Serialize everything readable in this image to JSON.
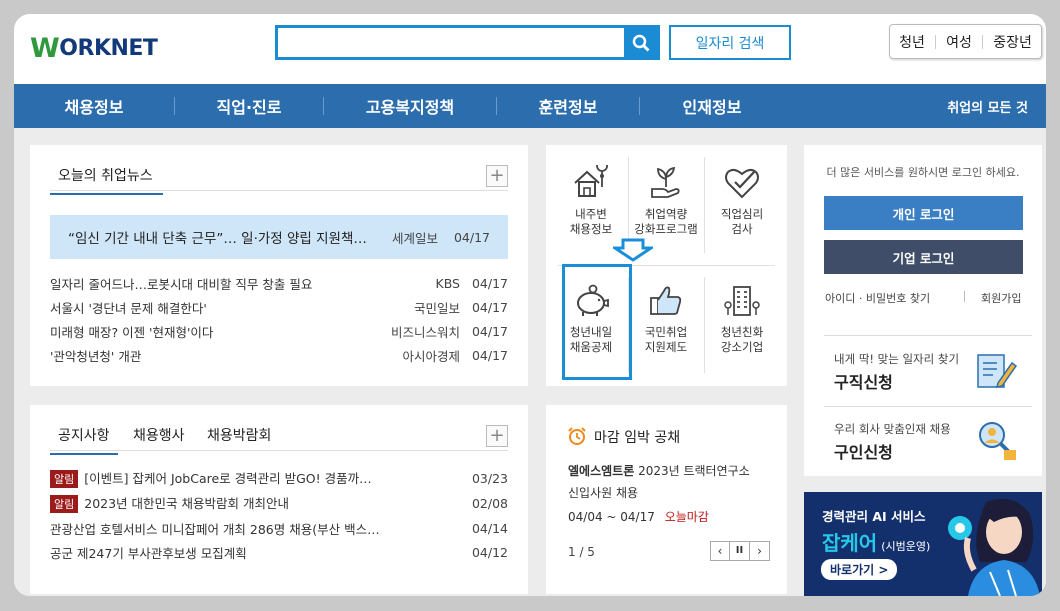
{
  "header": {
    "logo_w": "W",
    "logo_rest": "ORKNET",
    "search_placeholder": "",
    "job_search_label": "일자리 검색",
    "user_types": [
      "청년",
      "여성",
      "중장년"
    ]
  },
  "nav": {
    "items": [
      "채용정보",
      "직업·진로",
      "고용복지정책",
      "훈련정보",
      "인재정보"
    ],
    "all_label": "취업의 모든 것"
  },
  "news": {
    "title": "오늘의 취업뉴스",
    "featured": {
      "title": "“임신 기간 내내 단축 근무”… 일·가정 양립 지원책…",
      "source": "세계일보",
      "date": "04/17"
    },
    "items": [
      {
        "title": "일자리 줄어드나…로봇시대 대비할 직무 창출 필요",
        "source": "KBS",
        "date": "04/17"
      },
      {
        "title": "서울시 '경단녀 문제 해결한다'",
        "source": "국민일보",
        "date": "04/17"
      },
      {
        "title": "미래형 매장? 이젠 '현재형'이다",
        "source": "비즈니스워치",
        "date": "04/17"
      },
      {
        "title": "'관악청년청' 개관",
        "source": "아시아경제",
        "date": "04/17"
      }
    ]
  },
  "notices": {
    "tabs": [
      "공지사항",
      "채용행사",
      "채용박람회"
    ],
    "items": [
      {
        "badge": "알림",
        "title": "[이벤트] 잡케어 JobCare로 경력관리 받GO! 경품까…",
        "date": "03/23"
      },
      {
        "badge": "알림",
        "title": "2023년 대한민국 채용박람회 개최안내",
        "date": "02/08"
      },
      {
        "badge": "",
        "title": "관광산업 호텔서비스 미니잡페어 개최 286명 채용(부산 백스…",
        "date": "04/14"
      },
      {
        "badge": "",
        "title": "공군 제247기 부사관후보생 모집계획",
        "date": "04/12"
      }
    ]
  },
  "services": {
    "row1": [
      {
        "icon": "house-location-icon",
        "line1": "내주변",
        "line2": "채용정보"
      },
      {
        "icon": "plant-hand-icon",
        "line1": "취업역량",
        "line2": "강화프로그램"
      },
      {
        "icon": "heart-check-icon",
        "line1": "직업심리",
        "line2": "검사"
      }
    ],
    "row2": [
      {
        "icon": "piggy-bank-icon",
        "line1": "청년내일",
        "line2": "채움공제"
      },
      {
        "icon": "thumbs-up-icon",
        "line1": "국민취업",
        "line2": "지원제도"
      },
      {
        "icon": "building-icon",
        "line1": "청년친화",
        "line2": "강소기업"
      }
    ]
  },
  "deadline": {
    "title": "마감 임박 공채",
    "company": "엘에스엠트론",
    "desc1": "2023년 트랙터연구소",
    "desc2": "신입사원 채용",
    "period": "04/04 ~ 04/17",
    "status": "오늘마감",
    "page": "1 / 5"
  },
  "login": {
    "notice": "더 많은 서비스를 원하시면 로그인 하세요.",
    "personal": "개인 로그인",
    "company": "기업 로그인",
    "find": "아이디 · 비밀번호 찾기",
    "signup": "회원가입",
    "seek_sub": "내게 딱! 맞는 일자리 찾기",
    "seek_title": "구직신청",
    "hire_sub": "우리 회사 맞춤인재 채용",
    "hire_title": "구인신청"
  },
  "banner": {
    "line1": "경력관리 AI 서비스",
    "brand": "잡케어",
    "note": "(시범운영)",
    "cta": "바로가기 >"
  },
  "colors": {
    "nav": "#2c6ead",
    "accent": "#1b8bd3",
    "personal": "#3a7ec4",
    "company": "#3f4d68",
    "highlight": "#1a8fd8"
  }
}
